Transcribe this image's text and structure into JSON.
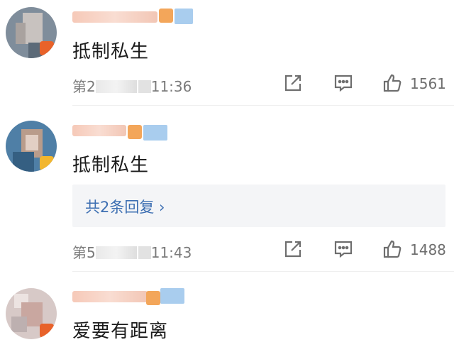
{
  "comments": [
    {
      "text": "抵制私生",
      "time_prefix": "第2",
      "time_suffix": "11:36",
      "likes": "1561",
      "avatar_color": "#7f8d9b",
      "badge_color": "#e8622a"
    },
    {
      "text": "抵制私生",
      "reply_link": "共2条回复 ›",
      "time_prefix": "第5",
      "time_suffix": "11:43",
      "likes": "1488",
      "avatar_color": "#4f7fa6",
      "badge_color": "#f2b62e"
    },
    {
      "text": "爱要有距离",
      "avatar_color": "#d7c9c7",
      "badge_color": "#e8622a"
    }
  ],
  "icons": [
    "share-icon",
    "comment-icon",
    "like-icon"
  ],
  "colors": {
    "link": "#3d6fb2",
    "meta": "#7a7a7a",
    "reply_bg": "#f4f5f7"
  }
}
